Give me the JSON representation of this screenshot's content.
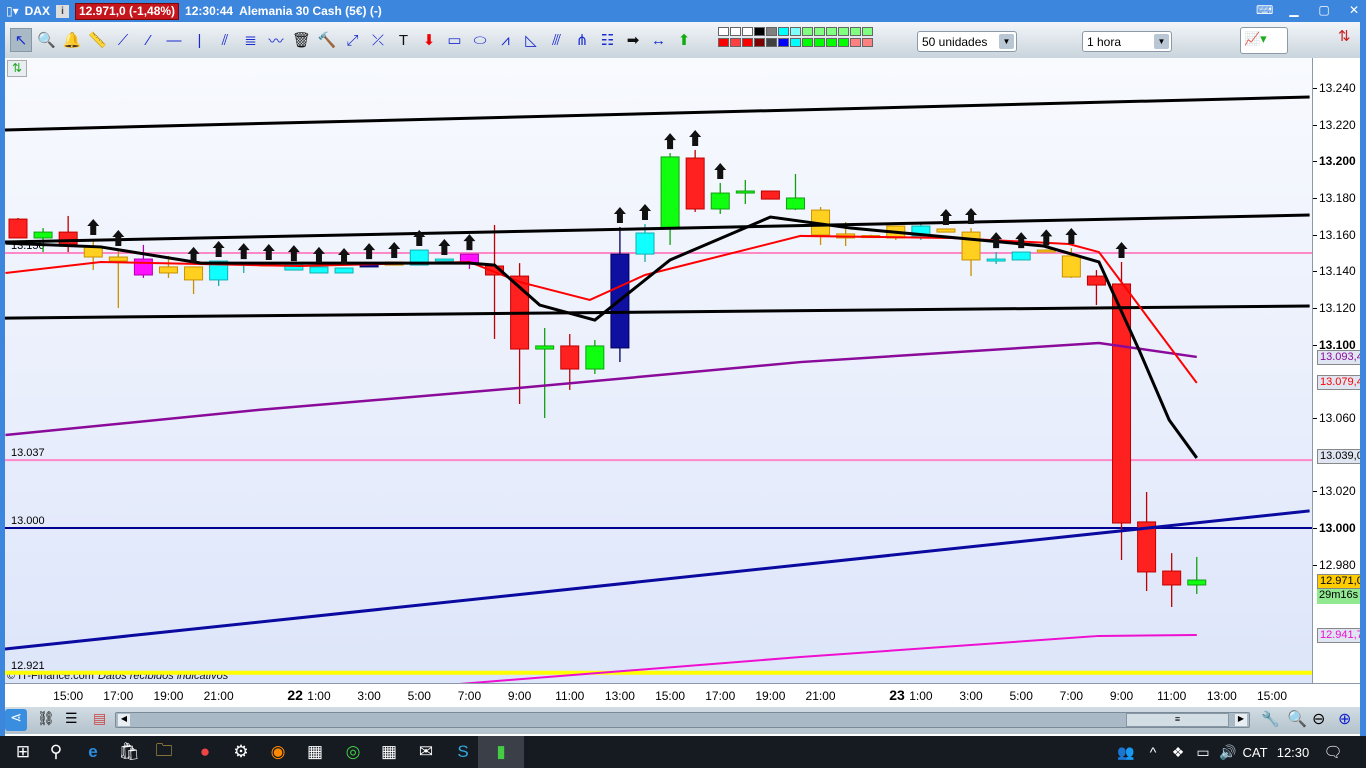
{
  "window": {
    "symbol": "DAX",
    "price_badge": "12.971,0 (-1,48%)",
    "time": "12:30:44",
    "instrument": "Alemania 30 Cash (5€) (-)"
  },
  "toolbar": {
    "tools": [
      "pointer-icon",
      "zoom-icon",
      "alert-bell-icon",
      "ruler-icon",
      "line-icon",
      "segment-icon",
      "horizontal-line-icon",
      "vertical-line-icon",
      "channel-icon",
      "fibonacci-icon",
      "trend-icon",
      "trash-icon",
      "settings-tools-icon",
      "point-icon",
      "parallel-icon",
      "text-icon",
      "down-arrow-icon",
      "rectangle-icon",
      "ellipse-icon",
      "zigzag-icon",
      "triangle-icon",
      "regression-icon",
      "pitchfork-icon",
      "list-icon",
      "right-arrow-icon",
      "span-icon",
      "up-arrow-icon"
    ],
    "swatches": [
      "#ffffff",
      "#ffffff",
      "#ffffff",
      "#000000",
      "#808080",
      "#00ffff",
      "#80ffff",
      "#80ff80",
      "#80ff80",
      "#80ff80",
      "#80ff80",
      "#80ff80",
      "#80ff80",
      "#ff0000",
      "#ff4040",
      "#ff0000",
      "#800000",
      "#404040",
      "#0000ff",
      "#00ffff",
      "#00ff00",
      "#00ff00",
      "#00ff00",
      "#00ff00",
      "#ff8080",
      "#ff8080"
    ],
    "units_select": "50 unidades",
    "interval_select": "1 hora"
  },
  "chart_data": {
    "type": "candlestick",
    "title": "DAX - Alemania 30 Cash (5€) 1 hora",
    "ylim": [
      12910,
      13260
    ],
    "candles": [
      [
        0,
        13168.5,
        13169.1,
        13158.2,
        13158.2,
        "red",
        0
      ],
      [
        1,
        13158.2,
        13163.6,
        13150.5,
        13161.4,
        "green",
        0
      ],
      [
        2,
        13161.4,
        13170.2,
        13150.5,
        13154.9,
        "red",
        0
      ],
      [
        3,
        13153.8,
        13157.6,
        13140.7,
        13147.8,
        "yellow",
        1
      ],
      [
        4,
        13147.8,
        13151.6,
        13120.0,
        13145.6,
        "yellow",
        1
      ],
      [
        5,
        13146.7,
        13154.4,
        13136.4,
        13138.0,
        "magenta",
        0
      ],
      [
        6,
        13142.4,
        13148.4,
        13136.4,
        13139.1,
        "yellow",
        0
      ],
      [
        7,
        13142.4,
        13142.4,
        13127.6,
        13135.3,
        "yellow",
        1
      ],
      [
        8,
        13135.3,
        13145.6,
        13132.0,
        13145.6,
        "cyan",
        1
      ],
      [
        9,
        13143.4,
        13144.5,
        13139.1,
        13144.5,
        "cyan",
        1
      ],
      [
        10,
        13144.0,
        13144.0,
        13142.9,
        13142.9,
        "yellow",
        1
      ],
      [
        11,
        13140.7,
        13143.4,
        13140.7,
        13143.4,
        "cyan",
        1
      ],
      [
        12,
        13139.1,
        13142.4,
        13139.1,
        13142.4,
        "cyan",
        1
      ],
      [
        13,
        13139.1,
        13141.8,
        13139.1,
        13141.8,
        "cyan",
        1
      ],
      [
        14,
        13142.4,
        13144.5,
        13142.4,
        13144.5,
        "blue",
        1
      ],
      [
        15,
        13145.1,
        13145.1,
        13143.4,
        13143.4,
        "yellow",
        1
      ],
      [
        16,
        13143.4,
        13151.6,
        13143.4,
        13151.6,
        "cyan",
        1
      ],
      [
        17,
        13145.6,
        13146.7,
        13145.6,
        13146.7,
        "cyan",
        1
      ],
      [
        18,
        13144.0,
        13149.4,
        13141.3,
        13149.4,
        "magenta",
        1
      ],
      [
        19,
        13142.9,
        13165.3,
        13103.1,
        13138.0,
        "red",
        0
      ],
      [
        20,
        13137.4,
        13144.5,
        13067.6,
        13097.6,
        "red",
        0
      ],
      [
        21,
        13097.6,
        13109.1,
        13060.0,
        13099.3,
        "green",
        0
      ],
      [
        22,
        13099.3,
        13105.8,
        13075.3,
        13086.7,
        "red",
        0
      ],
      [
        23,
        13086.7,
        13102.5,
        13084.0,
        13099.3,
        "green",
        0
      ],
      [
        24,
        13098.2,
        13164.2,
        13090.5,
        13149.4,
        "blue",
        1
      ],
      [
        25,
        13149.4,
        13165.8,
        13145.1,
        13160.9,
        "cyan",
        1
      ],
      [
        26,
        13163.6,
        13204.5,
        13154.4,
        13202.4,
        "green",
        1
      ],
      [
        27,
        13201.8,
        13206.2,
        13172.4,
        13174.0,
        "red",
        1
      ],
      [
        28,
        13174.0,
        13188.2,
        13171.3,
        13182.7,
        "green",
        1
      ],
      [
        29,
        13182.7,
        13189.8,
        13176.7,
        13183.8,
        "green",
        0
      ],
      [
        30,
        13183.8,
        13183.8,
        13179.4,
        13179.4,
        "red",
        0
      ],
      [
        31,
        13174.0,
        13193.1,
        13173.4,
        13180.0,
        "green",
        0
      ],
      [
        32,
        13173.4,
        13175.1,
        13154.4,
        13159.8,
        "yellow",
        0
      ],
      [
        33,
        13160.4,
        13166.9,
        13153.8,
        13158.2,
        "yellow",
        0
      ],
      [
        34,
        13159.5,
        13160.0,
        13158.5,
        13159.0,
        "yellow",
        0
      ],
      [
        35,
        13164.7,
        13164.7,
        13157.1,
        13158.2,
        "yellow",
        0
      ],
      [
        36,
        13159.3,
        13165.8,
        13157.1,
        13164.7,
        "cyan",
        0
      ],
      [
        37,
        13163.1,
        13163.1,
        13161.4,
        13161.4,
        "yellow",
        1
      ],
      [
        38,
        13161.4,
        13163.6,
        13137.4,
        13146.2,
        "yellow",
        1
      ],
      [
        39,
        13145.6,
        13150.5,
        13144.0,
        13146.7,
        "cyan",
        1
      ],
      [
        40,
        13146.2,
        13150.5,
        13146.2,
        13150.5,
        "cyan",
        1
      ],
      [
        41,
        13151.6,
        13152.0,
        13150.5,
        13151.0,
        "yellow",
        1
      ],
      [
        42,
        13148.4,
        13152.7,
        13136.4,
        13136.9,
        "yellow",
        1
      ],
      [
        43,
        13137.4,
        13140.7,
        13121.6,
        13132.5,
        "red",
        0
      ],
      [
        44,
        13133.1,
        13145.1,
        12982.5,
        13002.7,
        "red",
        1
      ],
      [
        45,
        13003.3,
        13019.6,
        12965.6,
        12976.0,
        "red",
        0
      ],
      [
        46,
        12976.5,
        12986.3,
        12956.9,
        12968.9,
        "red",
        0
      ],
      [
        47,
        12968.9,
        12984.2,
        12964.0,
        12971.6,
        "green",
        0
      ]
    ],
    "lines": [
      {
        "name": "upper-channel-line",
        "color": "#000000",
        "width": 3,
        "points": [
          [
            -0.52,
            13217.1
          ],
          [
            51.5,
            13235.1
          ]
        ]
      },
      {
        "name": "middle-channel-line",
        "color": "#000000",
        "width": 3,
        "points": [
          [
            -0.52,
            13156.0
          ],
          [
            51.5,
            13170.7
          ]
        ]
      },
      {
        "name": "lower-channel-line",
        "color": "#000000",
        "width": 3,
        "points": [
          [
            -0.52,
            13114.5
          ],
          [
            51.5,
            13121.1
          ]
        ]
      },
      {
        "name": "blue-trend-line",
        "color": "#0a0aa0",
        "width": 3,
        "points": [
          [
            -0.52,
            12934.0
          ],
          [
            51.5,
            13009.3
          ]
        ]
      },
      {
        "name": "purple-moving-average",
        "color": "#8a0a9a",
        "width": 2.5,
        "points": [
          [
            -0.5,
            13050.7
          ],
          [
            9.6,
            13064.4
          ],
          [
            20,
            13076.4
          ],
          [
            31.2,
            13090.5
          ],
          [
            43.1,
            13100.9
          ],
          [
            47,
            13093.3
          ]
        ]
      },
      {
        "name": "magenta-moving-average",
        "color": "#ee10d0",
        "width": 2,
        "points": [
          [
            17.6,
            12914.9
          ],
          [
            31.2,
            12929.6
          ],
          [
            43.1,
            12941.1
          ],
          [
            47,
            12941.6
          ]
        ]
      },
      {
        "name": "red-moving-average",
        "color": "#ff0000",
        "width": 2,
        "points": [
          [
            -0.5,
            13139.1
          ],
          [
            3.3,
            13145.1
          ],
          [
            11.2,
            13142.9
          ],
          [
            18,
            13145.1
          ],
          [
            20,
            13134.2
          ],
          [
            22.8,
            13124.4
          ],
          [
            25,
            13138.0
          ],
          [
            31.2,
            13159.3
          ],
          [
            37.2,
            13158.2
          ],
          [
            41.9,
            13154.9
          ],
          [
            43.1,
            13150.5
          ],
          [
            47,
            13079.1
          ]
        ]
      },
      {
        "name": "black-moving-average",
        "color": "#000000",
        "width": 3,
        "points": [
          [
            -0.5,
            13155.4
          ],
          [
            3.3,
            13153.3
          ],
          [
            7.3,
            13144.5
          ],
          [
            18,
            13144.5
          ],
          [
            19,
            13143.4
          ],
          [
            20.8,
            13121.6
          ],
          [
            23,
            13113.4
          ],
          [
            26,
            13146.2
          ],
          [
            30,
            13169.6
          ],
          [
            33.2,
            13163.6
          ],
          [
            40.9,
            13153.8
          ],
          [
            43.1,
            13145.1
          ],
          [
            44.7,
            13097.1
          ],
          [
            45.9,
            13058.9
          ],
          [
            47,
            13038.2
          ]
        ]
      }
    ],
    "hlines": [
      {
        "name": "level-13150",
        "value": 13150,
        "color": "#ff88c8",
        "label": "13.150"
      },
      {
        "name": "level-13037",
        "value": 13037,
        "color": "#ff88c8",
        "label": "13.037"
      },
      {
        "name": "level-13000",
        "value": 13000,
        "color": "#000090",
        "label": "13.000"
      },
      {
        "name": "level-12921",
        "value": 12921,
        "color": "#ffff00",
        "label": "12.921"
      }
    ],
    "yticks": [
      [
        "13.240",
        13240,
        0
      ],
      [
        "13.220",
        13220,
        0
      ],
      [
        "13.200",
        13200,
        1
      ],
      [
        "13.180",
        13180,
        0
      ],
      [
        "13.160",
        13160,
        0
      ],
      [
        "13.140",
        13140,
        0
      ],
      [
        "13.120",
        13120,
        0
      ],
      [
        "13.100",
        13100,
        1
      ],
      [
        "13.060",
        13060,
        0
      ],
      [
        "13.020",
        13020,
        0
      ],
      [
        "13.000",
        13000,
        1
      ],
      [
        "12.980",
        12980,
        0
      ]
    ],
    "tags": [
      [
        "13.093,4",
        13093.4,
        "#8a0a9a",
        "#dfe6f1"
      ],
      [
        "13.079,4",
        13079.4,
        "#ff0000",
        "#dfe6f1"
      ],
      [
        "13.039,0",
        13039,
        "#000000",
        "#dfe6f1"
      ],
      [
        "12.971,0",
        12971,
        "#000000",
        "#ffcc00"
      ],
      [
        "12.941,7",
        12941.7,
        "#ee10d0",
        "#dfe6f1"
      ]
    ],
    "countdown": "29m16s",
    "xticks": [
      [
        2,
        "15:00",
        0
      ],
      [
        4,
        "17:00",
        0
      ],
      [
        6,
        "19:00",
        0
      ],
      [
        8,
        "21:00",
        0
      ],
      [
        11.05,
        "22",
        1
      ],
      [
        12,
        "1:00",
        0
      ],
      [
        14,
        "3:00",
        0
      ],
      [
        16,
        "5:00",
        0
      ],
      [
        18,
        "7:00",
        0
      ],
      [
        20,
        "9:00",
        0
      ],
      [
        22,
        "11:00",
        0
      ],
      [
        24,
        "13:00",
        0
      ],
      [
        26,
        "15:00",
        0
      ],
      [
        28,
        "17:00",
        0
      ],
      [
        30,
        "19:00",
        0
      ],
      [
        32,
        "21:00",
        0
      ],
      [
        35.05,
        "23",
        1
      ],
      [
        36,
        "1:00",
        0
      ],
      [
        38,
        "3:00",
        0
      ],
      [
        40,
        "5:00",
        0
      ],
      [
        42,
        "7:00",
        0
      ],
      [
        44,
        "9:00",
        0
      ],
      [
        46,
        "11:00",
        0
      ],
      [
        48,
        "13:00",
        0
      ],
      [
        50,
        "15:00",
        0
      ]
    ]
  },
  "credit": {
    "source": "© IT-Finance.com",
    "note": "Datos recibidos indicativos"
  },
  "taskbar": {
    "language": "CAT",
    "clock": "12:30"
  }
}
